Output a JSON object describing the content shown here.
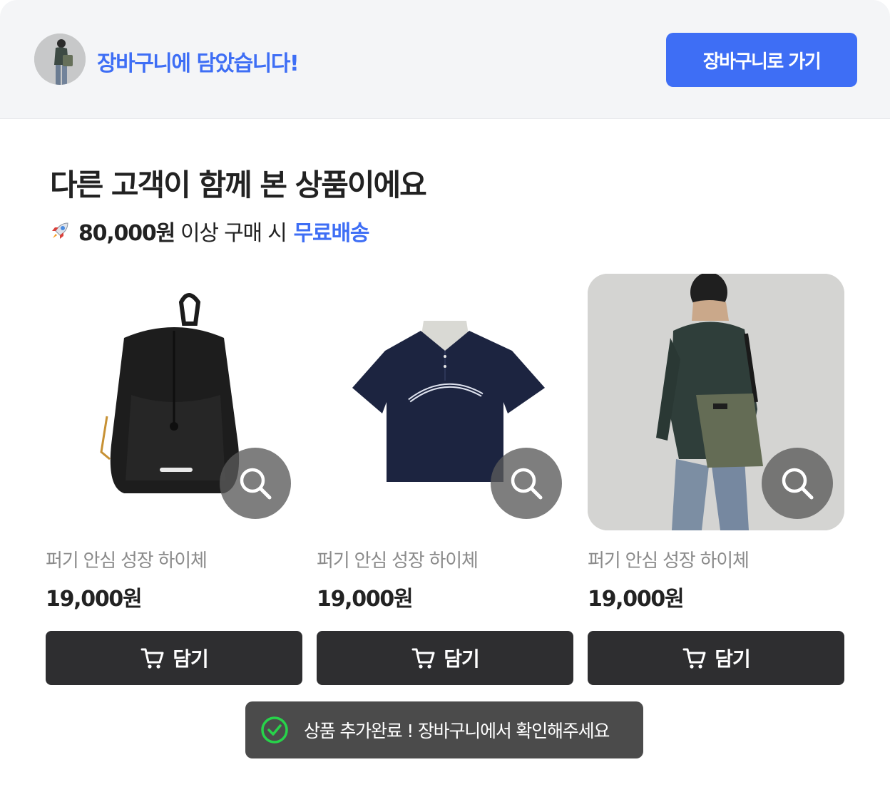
{
  "header": {
    "message": "장바구니에 담았습니다!",
    "go_cart_label": "장바구니로 가기"
  },
  "recommend": {
    "title": "다른 고객이 함께 본 상품이에요",
    "shipping_amount": "80,000원",
    "shipping_mid": "이상 구매 시",
    "shipping_free": "무료배송"
  },
  "products": [
    {
      "name": "퍼기 안심 성장 하이체",
      "price": "19,000원",
      "add_label": "담기",
      "image": "black-backpack"
    },
    {
      "name": "퍼기 안심 성장 하이체",
      "price": "19,000원",
      "add_label": "담기",
      "image": "navy-polo-shirt"
    },
    {
      "name": "퍼기 안심 성장 하이체",
      "price": "19,000원",
      "add_label": "담기",
      "image": "man-with-green-bag"
    }
  ],
  "toast": {
    "message": "상품 추가완료 ! 장바구니에서 확인해주세요"
  },
  "colors": {
    "accent": "#3e6ef5",
    "dark_button": "#2e2e30",
    "check_green": "#27d34a"
  }
}
